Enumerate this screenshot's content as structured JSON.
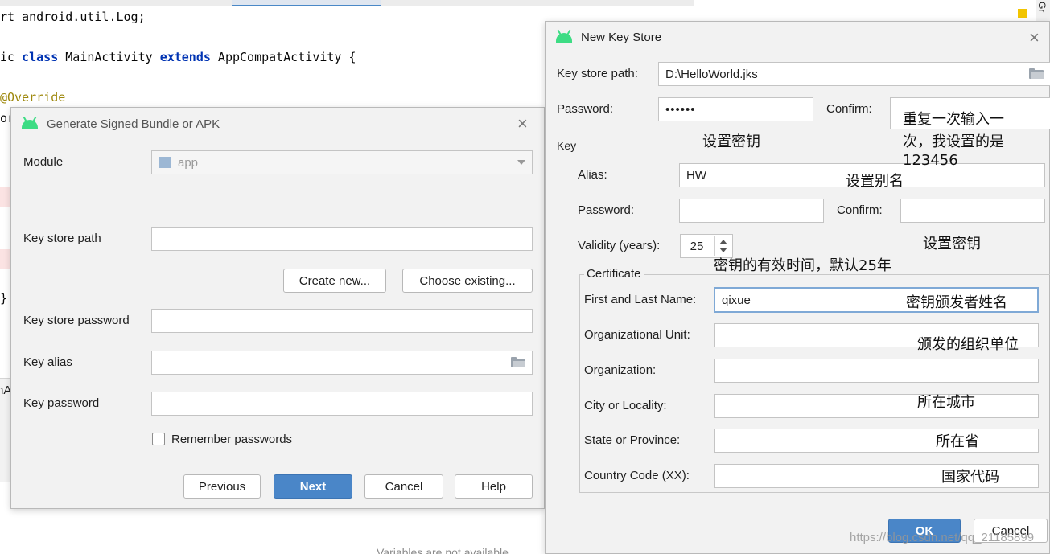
{
  "editor": {
    "code_lines": [
      {
        "text": "rt android.util.Log;"
      },
      {
        "pre": "ic ",
        "kw1": "class",
        "mid": " MainActivity ",
        "kw2": "extends",
        "post": " AppCompatActivity {"
      },
      {
        "ann": "@Override"
      },
      {
        "text": "or"
      },
      {
        "text": "}"
      }
    ],
    "side_fragment": "nA",
    "right_tab_text": "Gr",
    "bottom_note": "Variables are not available"
  },
  "signed_dialog": {
    "title": "Generate Signed Bundle or APK",
    "module_label": "Module",
    "module_value": "app",
    "key_store_path_label": "Key store path",
    "key_store_path_value": "",
    "create_new_label": "Create new...",
    "choose_existing_label": "Choose existing...",
    "key_store_password_label": "Key store password",
    "key_alias_label": "Key alias",
    "key_password_label": "Key password",
    "remember_label": "Remember passwords",
    "previous_label": "Previous",
    "next_label": "Next",
    "cancel_label": "Cancel",
    "help_label": "Help"
  },
  "keystore_dialog": {
    "title": "New Key Store",
    "path_label": "Key store path:",
    "path_value": "D:\\HelloWorld.jks",
    "password_label": "Password:",
    "password_value": "••••••",
    "confirm_label": "Confirm:",
    "key_section": "Key",
    "alias_label": "Alias:",
    "alias_value": "HW",
    "key_password_label": "Password:",
    "key_confirm_label": "Confirm:",
    "validity_label": "Validity (years):",
    "validity_value": "25",
    "certificate_section": "Certificate",
    "first_last_label": "First and Last Name:",
    "first_last_value": "qixue",
    "org_unit_label": "Organizational Unit:",
    "org_label": "Organization:",
    "city_label": "City or Locality:",
    "state_label": "State or Province:",
    "country_label": "Country Code (XX):",
    "ok_label": "OK",
    "cancel_label": "Cancel"
  },
  "annotations": {
    "confirm_note_1": "重复一次输入一",
    "confirm_note_2": "次，我设置的是",
    "confirm_note_3": "123456",
    "store_password_note": "设置密钥",
    "alias_note": "设置别名",
    "key_password_note": "设置密钥",
    "validity_note": "密钥的有效时间，默认25年",
    "name_note": "密钥颁发者姓名",
    "org_unit_note": "颁发的组织单位",
    "city_note": "所在城市",
    "state_note": "所在省",
    "country_note": "国家代码"
  },
  "watermark": "https://blog.csdn.net/qq_21185899",
  "colors": {
    "primary_button": "#4a86c8",
    "android_green": "#3ddc84",
    "keyword": "#0033b3",
    "annotation": "#9e880d"
  }
}
